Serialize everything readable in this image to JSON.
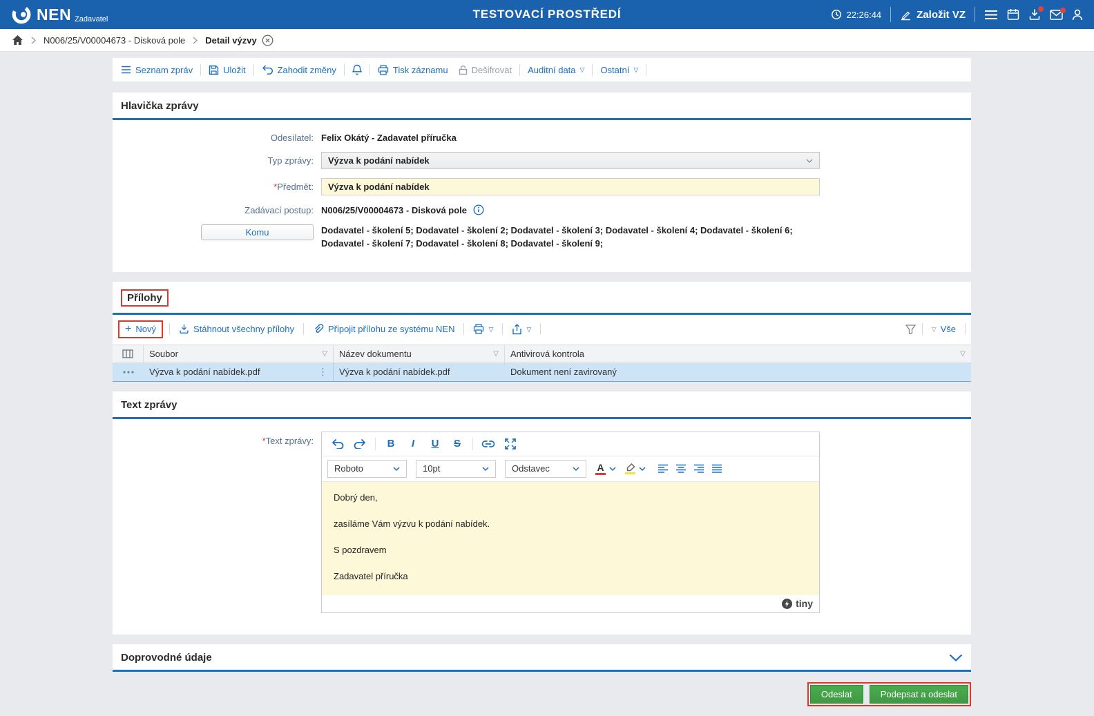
{
  "colors": {
    "topbar_blue": "#1a61ae",
    "link_blue": "#1b6fc0",
    "accent_rule_blue": "#1d70ba",
    "input_yellow": "#fcf8d8",
    "selected_row_blue": "#cde4f7",
    "green_button": "#43a047",
    "annotation_red": "#dc382d"
  },
  "ui": {
    "required_marker": "*"
  },
  "icons": {
    "dropdown_triangle": "▽",
    "kebab_vertical": "⋮",
    "plus": "+",
    "font_color_letter": "A"
  },
  "topbar": {
    "app_name": "NEN",
    "app_subtitle": "Zadavatel",
    "environment_title": "TESTOVACÍ PROSTŘEDÍ",
    "time": "22:26:44",
    "create_vz": "Založit VZ"
  },
  "breadcrumb": {
    "procedure": "N006/25/V00004673 - Disková pole",
    "current": "Detail výzvy"
  },
  "toolbar": {
    "seznam_zprav": "Seznam zpráv",
    "ulozit": "Uložit",
    "zahodit_zmeny": "Zahodit změny",
    "tisk_zaznamu": "Tisk záznamu",
    "desifrovat": "Dešifrovat",
    "auditni_data": "Auditní data",
    "ostatni": "Ostatní"
  },
  "hlavicka": {
    "title": "Hlavička zprávy",
    "odesilatel_label": "Odesílatel:",
    "odesilatel_value": "Felix Okátý - Zadavatel příručka",
    "typ_zpravy_label": "Typ zprávy:",
    "typ_zpravy_value": "Výzva k podání nabídek",
    "predmet_label": "Předmět:",
    "predmet_value": "Výzva k podání nabídek",
    "zadavaci_postup_label": "Zadávací postup:",
    "zadavaci_postup_value": "N006/25/V00004673 - Disková pole",
    "komu_button": "Komu",
    "komu_value": "Dodavatel - školení 5; Dodavatel - školení 2; Dodavatel - školení 3; Dodavatel - školení 4; Dodavatel - školení 6; Dodavatel - školení 7; Dodavatel - školení 8; Dodavatel - školení 9;"
  },
  "prilohy": {
    "title": "Přílohy",
    "novy": "Nový",
    "stahnout_vsechny": "Stáhnout všechny přílohy",
    "pripojit": "Připojit přílohu ze systému NEN",
    "vse": "Vše",
    "columns": {
      "soubor": "Soubor",
      "nazev": "Název dokumentu",
      "antivir": "Antivirová kontrola"
    },
    "row": {
      "soubor": "Výzva k podání nabídek.pdf",
      "nazev": "Výzva k podání nabídek.pdf",
      "antivir": "Dokument není zavirovaný"
    }
  },
  "text_zpravy": {
    "title": "Text zprávy",
    "label": "Text zprávy:",
    "buttons": {
      "bold": "B",
      "italic": "I",
      "underline": "U",
      "strike": "S"
    },
    "font_name": "Roboto",
    "font_size": "10pt",
    "block_format": "Odstavec",
    "lines": [
      "Dobrý den,",
      "zasíláme Vám výzvu k podání nabídek.",
      "S pozdravem",
      "Zadavatel příručka"
    ],
    "editor_brand": "tiny"
  },
  "doprovodne": {
    "title": "Doprovodné údaje"
  },
  "footer": {
    "odeslat": "Odeslat",
    "podepsat_a_odeslat": "Podepsat a odeslat"
  }
}
